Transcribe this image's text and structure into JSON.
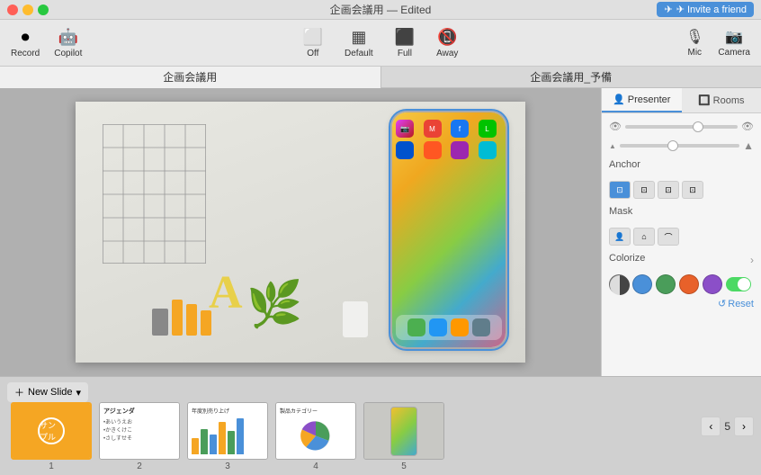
{
  "titlebar": {
    "title": "企画会議用 — Edited",
    "invite_label": "✈ Invite a friend"
  },
  "toolbar": {
    "record_label": "Record",
    "copilot_label": "Copilot",
    "off_label": "Off",
    "default_label": "Default",
    "full_label": "Full",
    "away_label": "Away",
    "mic_label": "Mic",
    "camera_label": "Camera"
  },
  "tabs": [
    {
      "label": "企画会議用",
      "active": true
    },
    {
      "label": "企画会議用_予備",
      "active": false
    }
  ],
  "panel": {
    "presenter_label": "Presenter",
    "rooms_label": "Rooms",
    "anchor_label": "Anchor",
    "mask_label": "Mask",
    "colorize_label": "Colorize",
    "reset_label": "Reset"
  },
  "filmstrip": {
    "new_slide_label": "New Slide",
    "page_num": "5",
    "slides": [
      {
        "num": "1",
        "type": "orange",
        "label": "サンプル"
      },
      {
        "num": "2",
        "type": "agenda",
        "title": "アジェンダ",
        "lines": [
          "•あいうえお",
          "•かきくけこ",
          "•さしすせそ"
        ]
      },
      {
        "num": "3",
        "type": "bar",
        "title": "年度別売り上げ"
      },
      {
        "num": "4",
        "type": "pie",
        "title": "製品カテゴリー"
      },
      {
        "num": "5",
        "type": "phone",
        "title": ""
      }
    ],
    "bars": [
      {
        "height": 20,
        "color": "#f5a623"
      },
      {
        "height": 30,
        "color": "#4a9d5a"
      },
      {
        "height": 25,
        "color": "#4a90d9"
      },
      {
        "height": 38,
        "color": "#f5a623"
      },
      {
        "height": 28,
        "color": "#4a9d5a"
      },
      {
        "height": 42,
        "color": "#4a90d9"
      }
    ]
  },
  "colors": [
    {
      "value": "#888888",
      "name": "gray"
    },
    {
      "value": "#4a90d9",
      "name": "blue"
    },
    {
      "value": "#4a9d5a",
      "name": "green"
    },
    {
      "value": "#e8612a",
      "name": "orange"
    },
    {
      "value": "#8b4fc8",
      "name": "purple"
    }
  ],
  "anchor_icons": [
    "⊡",
    "⊡",
    "⊡",
    "⊡"
  ],
  "mask_icons": [
    "👤",
    "⌂",
    "⌒"
  ]
}
